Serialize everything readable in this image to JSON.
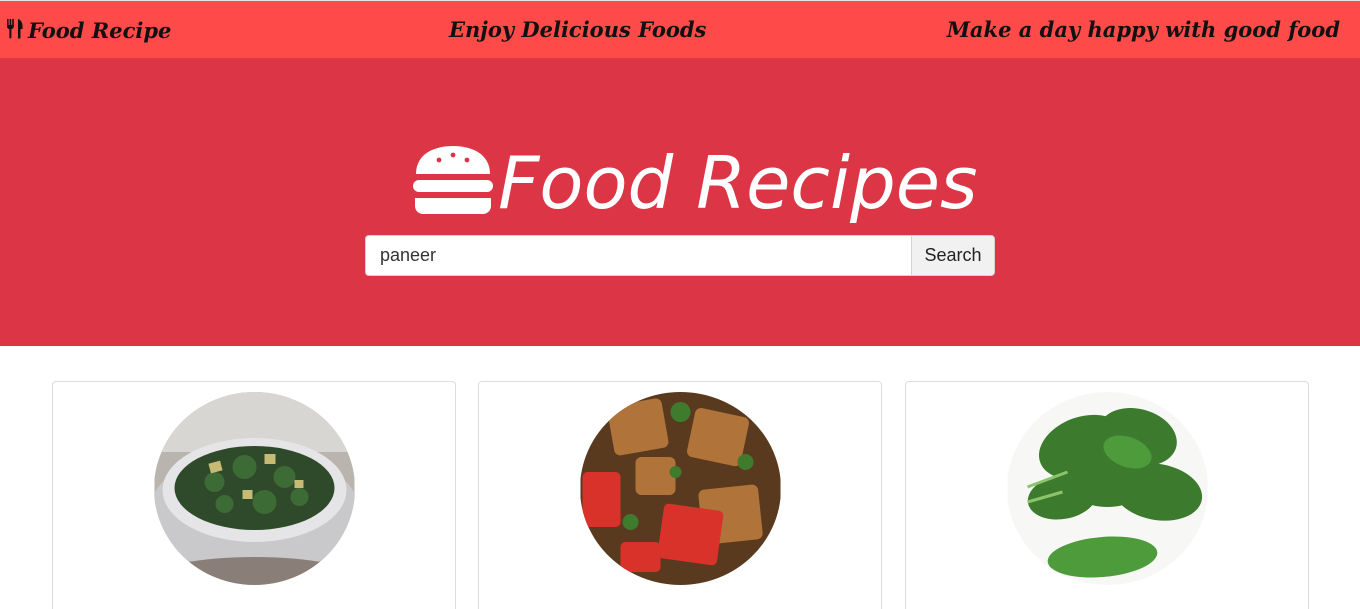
{
  "topbar": {
    "brand": "Food Recipe",
    "tagline_center": "Enjoy Delicious Foods",
    "tagline_right": "Make a day happy with good food",
    "brand_icon": "utensils-icon"
  },
  "hero": {
    "title": "Food Recipes",
    "icon": "hamburger-icon"
  },
  "search": {
    "value": "paneer",
    "button_label": "Search"
  },
  "recipes": [
    {
      "image": "kale-paneer-bowl"
    },
    {
      "image": "paneer-tikka"
    },
    {
      "image": "spinach-leaves"
    }
  ],
  "colors": {
    "topbar": "#ff4a4a",
    "hero": "#dc3545",
    "white": "#ffffff"
  }
}
